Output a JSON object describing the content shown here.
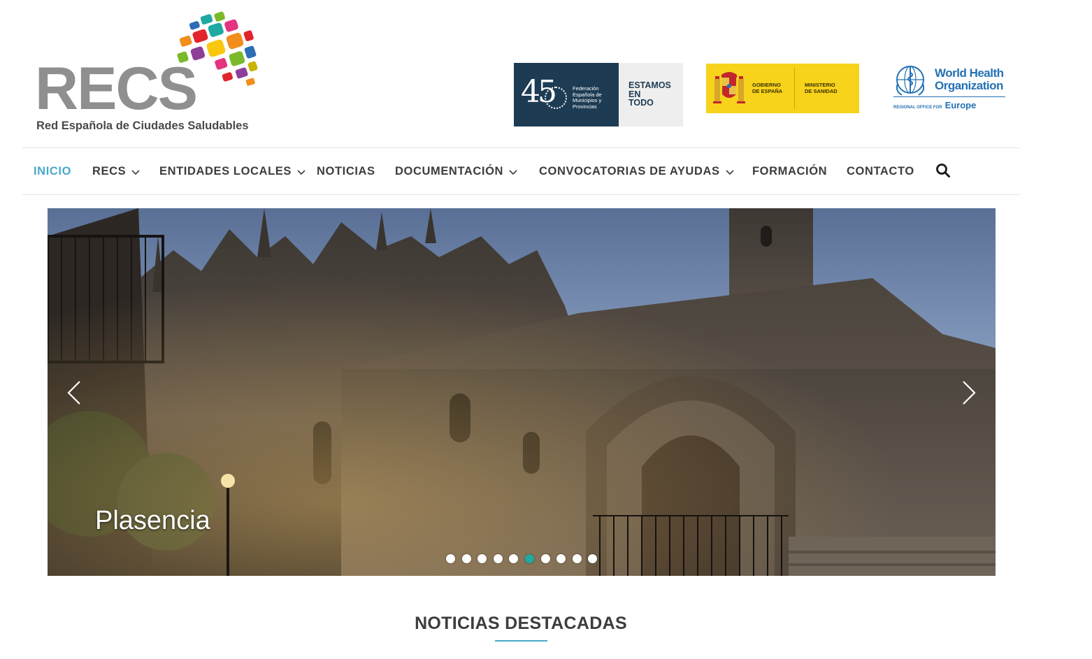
{
  "header": {
    "logo": {
      "wordmark": "RECS",
      "subtitle": "Red Española de Ciudades Saludables",
      "mosaic_colors": [
        "#e2242c",
        "#f28e1c",
        "#f9c80e",
        "#7ab929",
        "#1fa9a3",
        "#2d6db5",
        "#8f3e97",
        "#e4337f",
        "#c8b400"
      ]
    },
    "partners": {
      "femp": {
        "number": "45",
        "name_lines": [
          "Federación",
          "Española de",
          "Municipios y",
          "Provincias"
        ],
        "slogan_lines": [
          "ESTAMOS",
          "EN",
          "TODO"
        ]
      },
      "gobierno": {
        "left_lines": [
          "GOBIERNO",
          "DE ESPAÑA"
        ],
        "right_lines": [
          "MINISTERIO",
          "DE SANIDAD"
        ]
      },
      "who": {
        "name_lines": [
          "World Health",
          "Organization"
        ],
        "region_prefix": "REGIONAL OFFICE FOR",
        "region": "Europe"
      }
    }
  },
  "nav": {
    "items": [
      {
        "label": "INICIO",
        "active": true
      },
      {
        "label": "RECS",
        "dropdown": true
      },
      {
        "label": "ENTIDADES LOCALES",
        "dropdown": true
      },
      {
        "label": "NOTICIAS"
      },
      {
        "label": "DOCUMENTACIÓN",
        "dropdown": true
      },
      {
        "label": "CONVOCATORIAS DE AYUDAS",
        "dropdown": true
      },
      {
        "label": "FORMACIÓN"
      },
      {
        "label": "CONTACTO"
      }
    ],
    "search_icon": "search-icon"
  },
  "slider": {
    "caption": "Plasencia",
    "slide_count": 10,
    "active_index": 5,
    "prev_icon": "chevron-left-icon",
    "next_icon": "chevron-right-icon"
  },
  "section": {
    "title": "NOTICIAS DESTACADAS"
  },
  "colors": {
    "accent": "#4aa8c8",
    "active_dot": "#1fa9a3",
    "text": "#3d3d3d"
  }
}
